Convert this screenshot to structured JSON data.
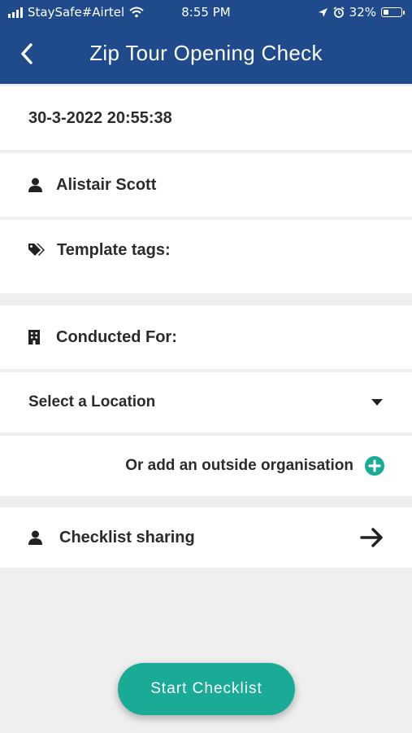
{
  "status_bar": {
    "carrier": "StaySafe#Airtel",
    "time": "8:55 PM",
    "battery_percent": "32%",
    "battery_level": 0.32
  },
  "header": {
    "title": "Zip Tour Opening Check",
    "back_icon": "chevron-left-icon",
    "background_color": "#1f4a8c"
  },
  "form": {
    "datetime": "30-3-2022 20:55:38",
    "user_name": "Alistair Scott",
    "template_tags_label": "Template tags:",
    "conducted_for_label": "Conducted For:",
    "location_select_value": "Select a Location",
    "add_org_label": "Or add an outside organisation",
    "checklist_sharing_label": "Checklist sharing"
  },
  "actions": {
    "start_label": "Start Checklist",
    "accent_color": "#1aab97"
  }
}
